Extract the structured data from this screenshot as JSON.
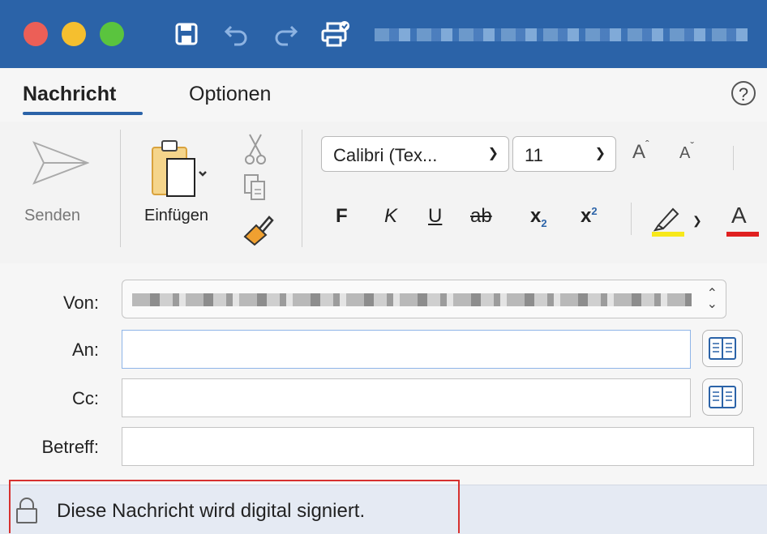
{
  "window": {
    "title": "",
    "colors": {
      "titlebar": "#2b63a8",
      "close": "#ec5f57",
      "minimize": "#f5bf2f",
      "zoom": "#5ac43e"
    },
    "toolbar_icons": [
      "save-icon",
      "undo-icon",
      "redo-icon",
      "print-icon"
    ]
  },
  "tabs": {
    "message": "Nachricht",
    "options": "Optionen",
    "help": "?"
  },
  "ribbon": {
    "send": "Senden",
    "paste": "Einfügen",
    "font": "Calibri (Tex...",
    "size": "11",
    "grow": "A",
    "shrink": "A",
    "bold": "F",
    "italic": "K",
    "underline": "U",
    "strike": "ab",
    "subscript": "x",
    "subscript_digit": "2",
    "superscript": "x",
    "superscript_digit": "2",
    "font_color": "A",
    "highlight_color": "#f7e81a",
    "text_color": "#e02020"
  },
  "fields": {
    "from_label": "Von:",
    "to_label": "An:",
    "cc_label": "Cc:",
    "subject_label": "Betreff:",
    "to_value": "",
    "cc_value": "",
    "subject_value": ""
  },
  "banner": {
    "text": "Diese Nachricht wird digital signiert."
  }
}
